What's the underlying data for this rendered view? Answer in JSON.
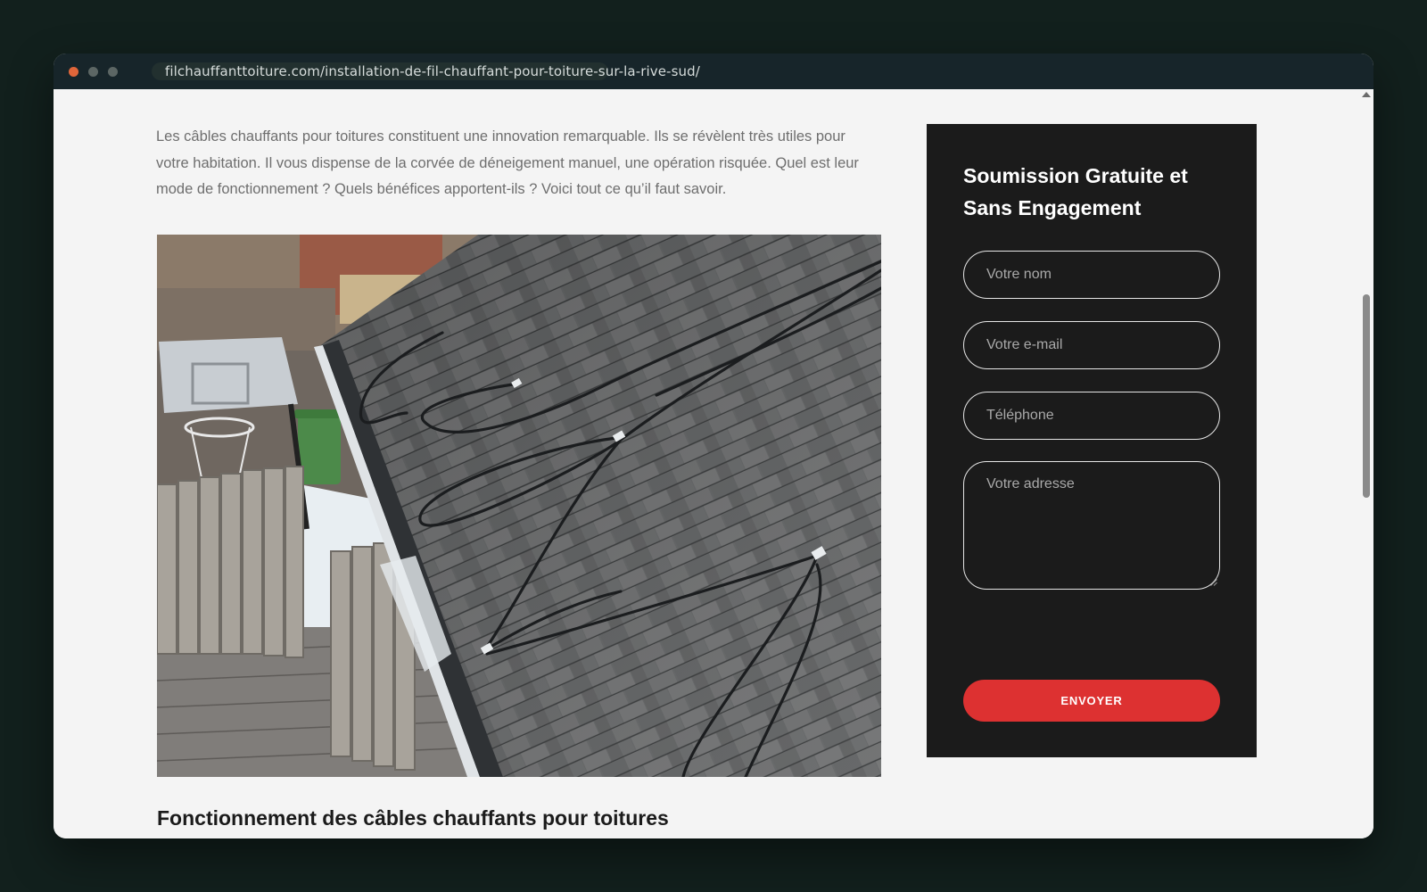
{
  "browser": {
    "url": "filchauffanttoiture.com/installation-de-fil-chauffant-pour-toiture-sur-la-rive-sud/"
  },
  "article": {
    "intro": "Les câbles chauffants pour toitures constituent une innovation remarquable. Ils se révèlent très utiles pour votre habitation. Il vous dispense de la corvée de déneigement manuel, une opération risquée. Quel est leur mode de fonctionnement ? Quels bénéfices apportent-ils ? Voici tout ce qu’il faut savoir.",
    "heading": "Fonctionnement des câbles chauffants pour toitures"
  },
  "form": {
    "title": "Soumission Gratuite et Sans Engagement",
    "name_placeholder": "Votre nom",
    "email_placeholder": "Votre e-mail",
    "phone_placeholder": "Téléphone",
    "address_placeholder": "Votre adresse",
    "submit_label": "ENVOYER"
  },
  "colors": {
    "page_bg": "#12201d",
    "card_bg": "#1b1b1b",
    "accent": "#dd3131",
    "window_close": "#e0663a"
  }
}
